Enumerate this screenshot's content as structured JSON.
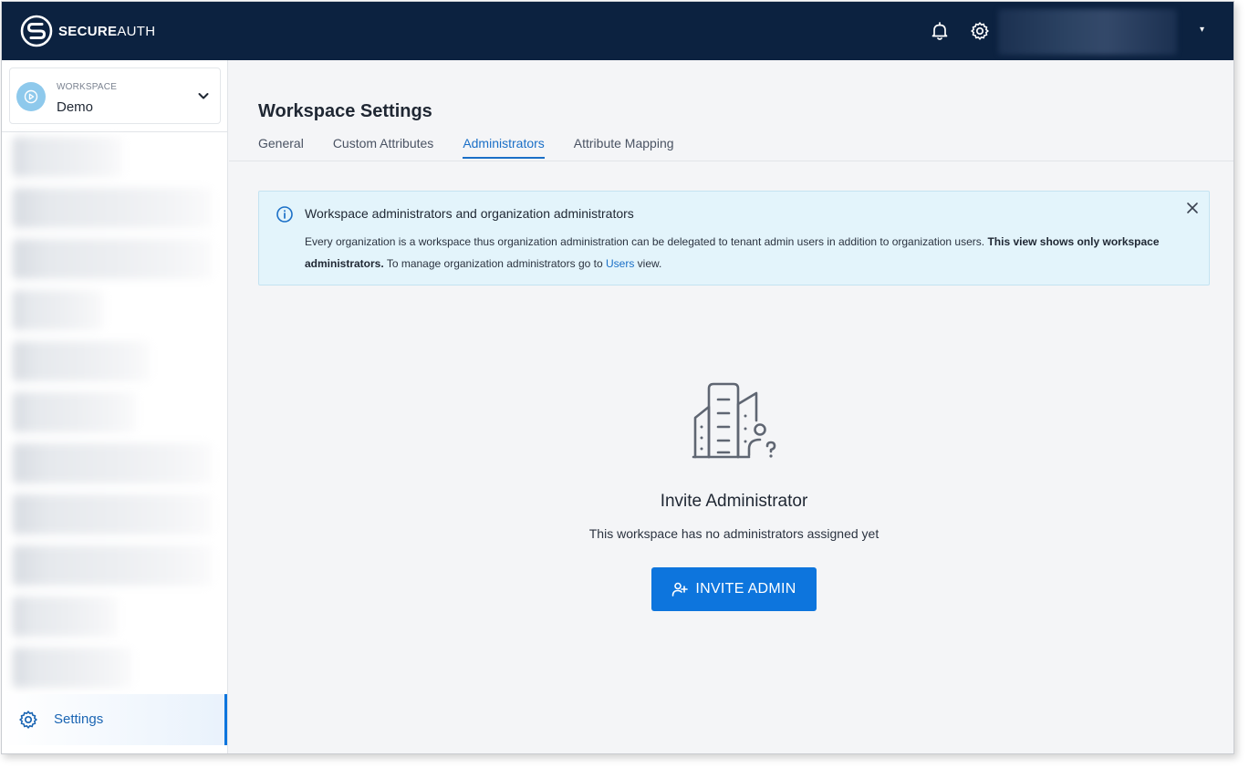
{
  "header": {
    "logo_bold": "SECURE",
    "logo_light": "AUTH",
    "icons": [
      "bell-icon",
      "gear-icon"
    ],
    "user_menu_caret": "▾"
  },
  "sidebar": {
    "workspace_label": "WORKSPACE",
    "workspace_name": "Demo",
    "settings_label": "Settings"
  },
  "page": {
    "title": "Workspace Settings",
    "tabs": [
      {
        "label": "General",
        "active": false
      },
      {
        "label": "Custom Attributes",
        "active": false
      },
      {
        "label": "Administrators",
        "active": true
      },
      {
        "label": "Attribute Mapping",
        "active": false
      }
    ]
  },
  "banner": {
    "title": "Workspace administrators and organization administrators",
    "text_1": "Every organization is a workspace thus organization administration can be delegated to tenant admin users in addition to organization users.",
    "text_bold": "This view shows only workspace administrators.",
    "text_2": "To manage organization administrators go to",
    "link": "Users",
    "text_3": "view."
  },
  "empty_state": {
    "title": "Invite Administrator",
    "subtitle": "This workspace has no administrators assigned yet",
    "button_label": "INVITE ADMIN"
  },
  "colors": {
    "topbar": "#0c2240",
    "accent": "#0d75dd",
    "banner_bg": "#e3f4fb"
  }
}
